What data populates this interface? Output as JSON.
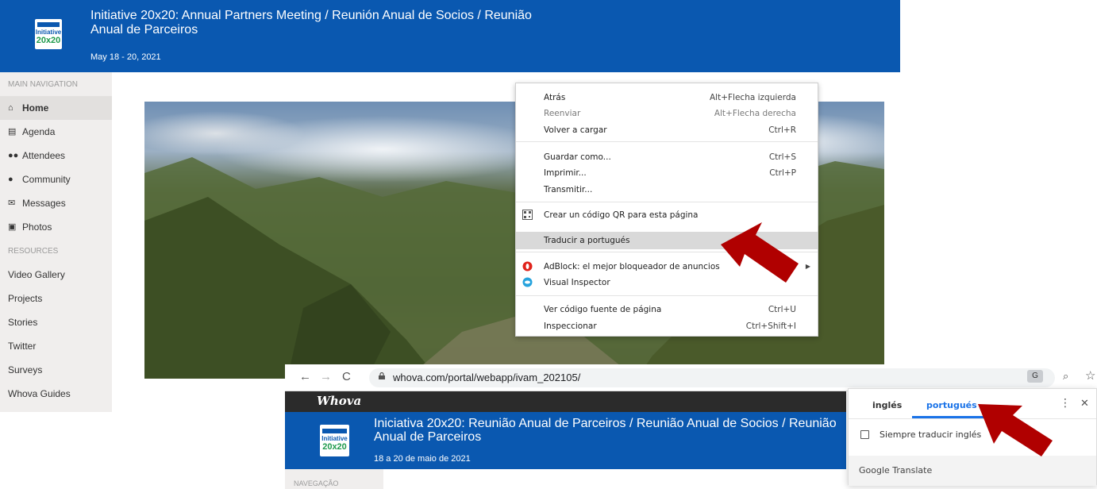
{
  "header": {
    "logo_line1": "Initiative",
    "logo_line2": "20x20",
    "title": "Initiative 20x20: Annual Partners Meeting / Reunión Anual de Socios / Reunião Anual de Parceiros",
    "date": "May 18 - 20, 2021"
  },
  "sidebar": {
    "section_main": "MAIN NAVIGATION",
    "main_items": [
      {
        "label": "Home",
        "icon": "home-icon",
        "active": true
      },
      {
        "label": "Agenda",
        "icon": "calendar-icon"
      },
      {
        "label": "Attendees",
        "icon": "users-icon"
      },
      {
        "label": "Community",
        "icon": "chat-icon"
      },
      {
        "label": "Messages",
        "icon": "envelope-icon"
      },
      {
        "label": "Photos",
        "icon": "camera-icon"
      }
    ],
    "section_resources": "RESOURCES",
    "resource_items": [
      "Video Gallery",
      "Projects",
      "Stories",
      "Twitter",
      "Surveys",
      "Whova Guides"
    ]
  },
  "context_menu": {
    "items": [
      {
        "label": "Atrás",
        "shortcut": "Alt+Flecha izquierda"
      },
      {
        "label": "Reenviar",
        "shortcut": "Alt+Flecha derecha",
        "disabled": true
      },
      {
        "label": "Volver a cargar",
        "shortcut": "Ctrl+R"
      },
      {
        "label": "Guardar como...",
        "shortcut": "Ctrl+S"
      },
      {
        "label": "Imprimir...",
        "shortcut": "Ctrl+P"
      },
      {
        "label": "Transmitir..."
      },
      {
        "label": "Crear un código QR para esta página",
        "icon": "qr-code-icon"
      },
      {
        "label": "Traducir a portugués",
        "highlighted": true
      },
      {
        "label": "AdBlock: el mejor bloqueador de anuncios",
        "icon": "adblock-icon"
      },
      {
        "label": "Visual Inspector",
        "icon": "visual-inspector-icon"
      },
      {
        "label": "Ver código fuente de página",
        "shortcut": "Ctrl+U"
      },
      {
        "label": "Inspeccionar",
        "shortcut": "Ctrl+Shift+I"
      }
    ]
  },
  "browser": {
    "url": "whova.com/portal/webapp/ivam_202105/",
    "translate_icon_glyph": "G",
    "back_glyph": "←",
    "forward_glyph": "→",
    "reload_glyph": "C",
    "zoom_glyph": "⌕",
    "star_glyph": "☆"
  },
  "translated_page": {
    "whova_logo": "Whova",
    "logo_line1": "Initiative",
    "logo_line2": "20x20",
    "title": "Iniciativa 20x20: Reunião Anual de Parceiros / Reunião Anual de Socios / Reunião Anual de Parceiros",
    "date": "18 a 20 de maio de 2021",
    "nav_section": "NAVEGAÇÃO"
  },
  "translate_popup": {
    "tab_source": "inglés",
    "tab_target": "portugués",
    "checkbox_label": "Siempre traducir inglés",
    "footer": "Google Translate",
    "more_glyph": "⋮",
    "close_glyph": "✕"
  },
  "colors": {
    "header_blue": "#0a58b0",
    "arrow_red": "#b00000",
    "link_blue": "#1a73e8"
  }
}
